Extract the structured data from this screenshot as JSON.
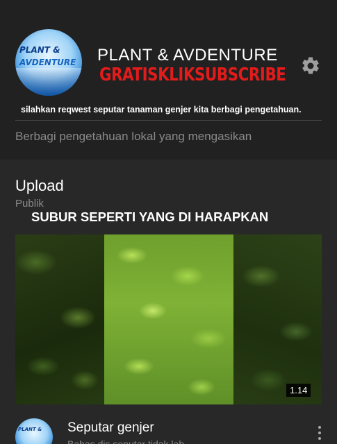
{
  "channel": {
    "avatar_text_line1": "PLANT &",
    "avatar_text_line2": "AVDENTURE",
    "title": "PLANT & AVDENTURE",
    "subtitle": "GRATISKLIKSUBSCRIBE",
    "description": "silahkan reqwest seputar tanaman genjer kita berbagi pengetahuan.",
    "tagline": "Berbagi pengetahuan lokal yang mengasikan",
    "accent_color": "#e31b1b",
    "settings_icon": "gear-icon"
  },
  "section": {
    "title": "Upload",
    "subtitle": "Publik"
  },
  "video": {
    "overlay_title": "SUBUR SEPERTI YANG DI HARAPKAN",
    "duration": "1.14"
  },
  "list_item": {
    "avatar_text": "PLANT &",
    "title": "Seputar genjer",
    "meta": "Bahas dis seputar tidak lah",
    "more_icon": "more-vert-icon"
  }
}
